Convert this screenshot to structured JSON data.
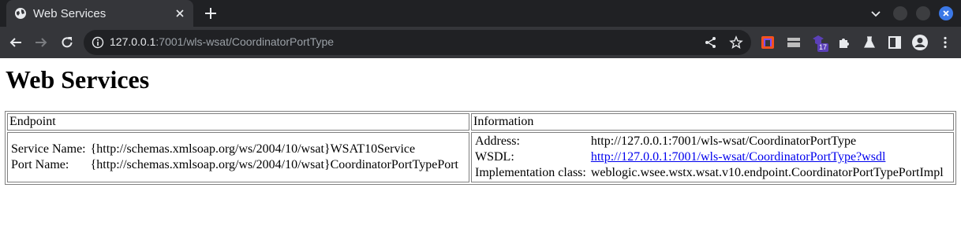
{
  "browser": {
    "tab_title": "Web Services",
    "url_host": "127.0.0.1",
    "url_rest": ":7001/wls-wsat/CoordinatorPortType",
    "extension_badge": "17",
    "icons": [
      "globe-icon",
      "close-icon",
      "plus-icon",
      "chevron-down-icon",
      "back-icon",
      "forward-icon",
      "reload-icon",
      "info-icon",
      "share-icon",
      "star-icon",
      "extension-icon",
      "puzzle-icon",
      "flask-icon",
      "sidebar-icon",
      "profile-icon",
      "menu-icon"
    ],
    "colors": {
      "tabstrip": "#202124",
      "toolbar": "#35363a",
      "omnibox": "#202124",
      "close_dot": "#3b78e7"
    }
  },
  "page": {
    "heading": "Web Services",
    "table": {
      "col_endpoint": "Endpoint",
      "col_information": "Information",
      "endpoint": {
        "service_label": "Service Name:",
        "service_value": "{http://schemas.xmlsoap.org/ws/2004/10/wsat}WSAT10Service",
        "port_label": "Port Name:",
        "port_value": "{http://schemas.xmlsoap.org/ws/2004/10/wsat}CoordinatorPortTypePort"
      },
      "information": {
        "address_label": "Address:",
        "address_value": "http://127.0.0.1:7001/wls-wsat/CoordinatorPortType",
        "wsdl_label": "WSDL:",
        "wsdl_value": "http://127.0.0.1:7001/wls-wsat/CoordinatorPortType?wsdl",
        "impl_label": "Implementation class:",
        "impl_value": "weblogic.wsee.wstx.wsat.v10.endpoint.CoordinatorPortTypePortImpl"
      }
    }
  }
}
